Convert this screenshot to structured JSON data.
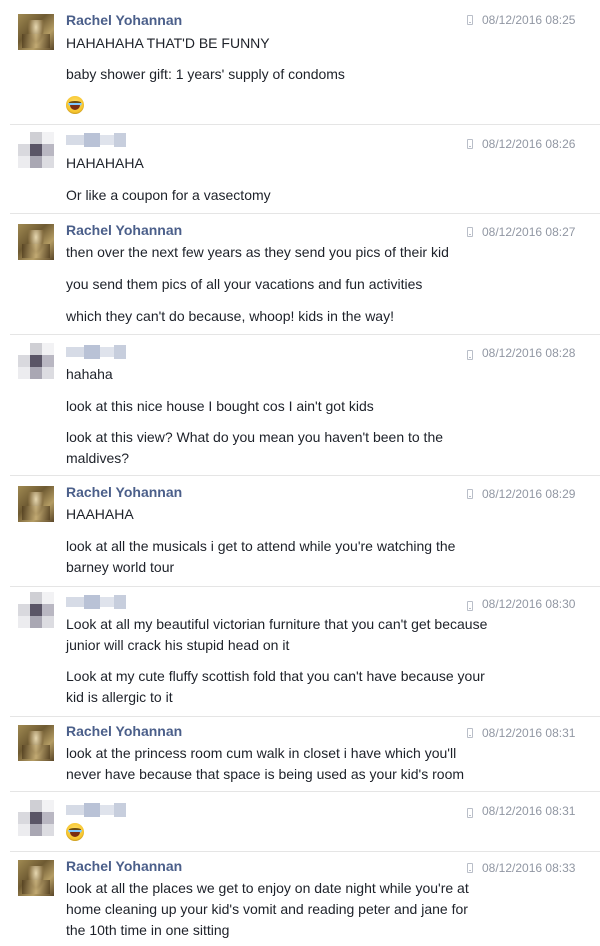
{
  "messages": [
    {
      "sender": "Rachel Yohannan",
      "time": "08/12/2016 08:25",
      "lines": [
        "HAHAHAHA THAT'D BE FUNNY",
        "baby shower gift: 1 years' supply of condoms"
      ],
      "emoji": "tears-of-joy-emoji"
    },
    {
      "sender": "",
      "time": "08/12/2016 08:26",
      "lines": [
        "HAHAHAHA",
        "Or like a coupon for a vasectomy"
      ]
    },
    {
      "sender": "Rachel Yohannan",
      "time": "08/12/2016 08:27",
      "lines": [
        "then over the next few years as they send you pics of their kid",
        "you send them pics of all your vacations and fun activities",
        "which they can't do because, whoop! kids in the way!"
      ]
    },
    {
      "sender": "",
      "time": "08/12/2016 08:28",
      "lines": [
        "hahaha",
        "look at this nice house I bought cos I ain't got kids",
        "look at this view? What do you mean you haven't been to the",
        "maldives?"
      ]
    },
    {
      "sender": "Rachel Yohannan",
      "time": "08/12/2016 08:29",
      "lines": [
        "HAAHAHA",
        "look at all the musicals i get to attend while you're watching the",
        "barney world tour"
      ]
    },
    {
      "sender": "",
      "time": "08/12/2016 08:30",
      "lines": [
        "Look at all my beautiful victorian furniture that you can't get because",
        "junior will crack his stupid head on it",
        "Look at my cute fluffy scottish fold that you can't have because your",
        "kid is allergic to it"
      ]
    },
    {
      "sender": "Rachel Yohannan",
      "time": "08/12/2016 08:31",
      "lines": [
        "look at the princess room cum walk in closet i have which you'll",
        "never have because that space is being used as your kid's room"
      ]
    },
    {
      "sender": "",
      "time": "08/12/2016 08:31",
      "lines": [],
      "emoji": "tears-of-joy-emoji"
    },
    {
      "sender": "Rachel Yohannan",
      "time": "08/12/2016 08:33",
      "lines": [
        "look at all the places we get to enjoy on date night while you're at",
        "home cleaning up your kid's vomit and reading peter and jane for",
        "the 10th time in one sitting"
      ]
    }
  ]
}
